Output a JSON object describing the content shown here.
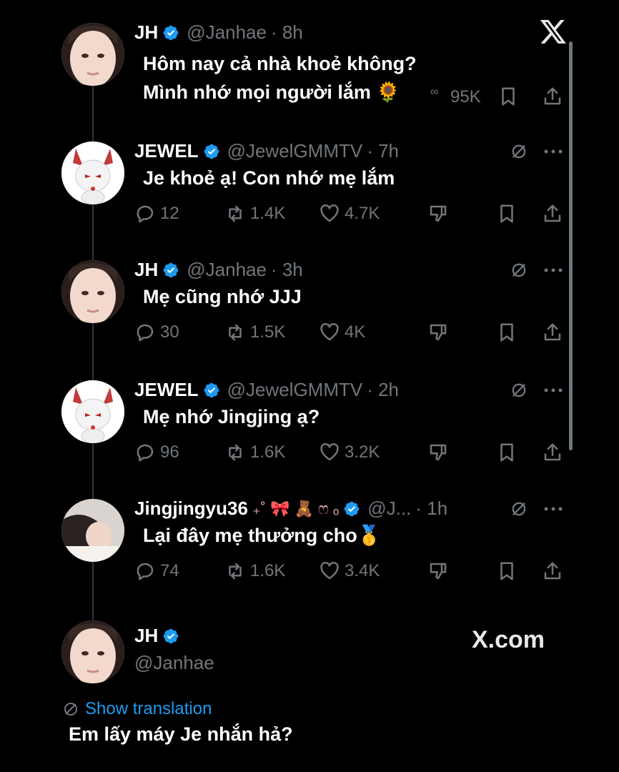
{
  "brand": {
    "logo": "X",
    "site": "X.com"
  },
  "tweets": [
    {
      "name": "JH",
      "handle": "@Janhae",
      "time": "· 8h",
      "lines": [
        "Hôm nay cả nhà khoẻ không?",
        "Mình nhớ mọi người lắm 🌻"
      ],
      "partial_count": "95K",
      "avatar": "jh-avatar"
    },
    {
      "name": "JEWEL",
      "handle": "@JewelGMMTV",
      "time": "· 7h",
      "text": "Je khoẻ ạ! Con nhớ mẹ lắm",
      "replies": "12",
      "reposts": "1.4K",
      "likes": "4.7K",
      "avatar": "jewel-avatar"
    },
    {
      "name": "JH",
      "handle": "@Janhae",
      "time": "· 3h",
      "text": "Mẹ cũng nhớ JJJ",
      "replies": "30",
      "reposts": "1.5K",
      "likes": "4K",
      "avatar": "jh-avatar"
    },
    {
      "name": "JEWEL",
      "handle": "@JewelGMMTV",
      "time": "· 2h",
      "text": "Mẹ nhớ Jingjing ạ?",
      "replies": "96",
      "reposts": "1.6K",
      "likes": "3.2K",
      "avatar": "jewel-avatar"
    },
    {
      "name": "Jingjingyu36",
      "name_deco": "₊˚ 🎀 🧸 ෆ ₒ",
      "handle": "@J...",
      "time": "· 1h",
      "text": "Lại đây mẹ thưởng cho🥇",
      "replies": "74",
      "reposts": "1.6K",
      "likes": "3.4K",
      "avatar": "jingjing-avatar"
    }
  ],
  "final_tweet": {
    "name": "JH",
    "handle": "@Janhae",
    "show_translation": "Show translation",
    "text": "Em lấy máy Je nhắn hả?"
  },
  "colors": {
    "background": "#000000",
    "muted": "#71767b",
    "link": "#1d9bf0",
    "verified": "#1d9bf0"
  }
}
